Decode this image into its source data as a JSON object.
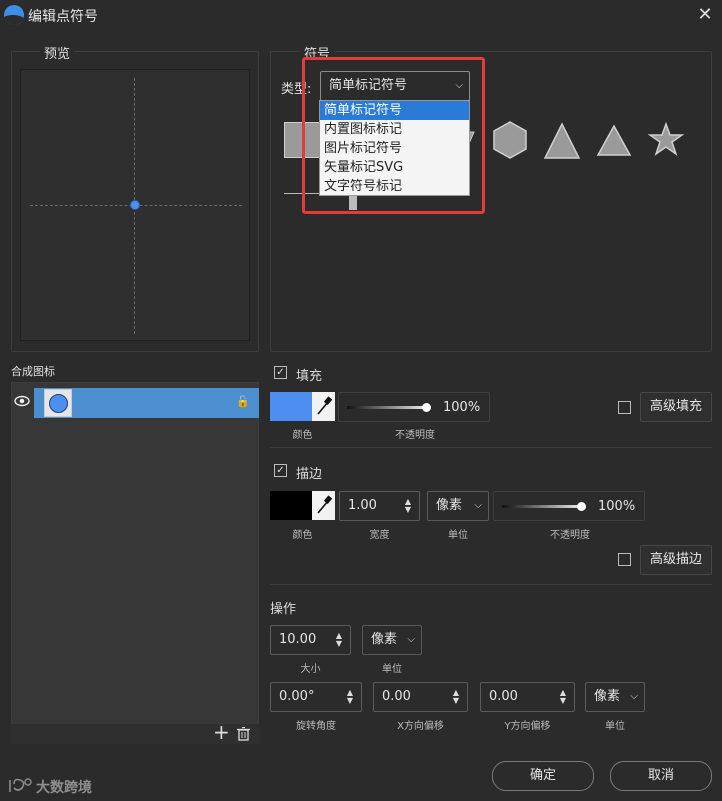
{
  "window": {
    "title": "编辑点符号",
    "close_glyph": "✕"
  },
  "preview": {
    "title": "预览",
    "point_color": "#4d8ff0"
  },
  "symbol": {
    "title": "符号",
    "type_label": "类型:",
    "type_value": "简单标记符号",
    "options": [
      "简单标记符号",
      "内置图标标记",
      "图片标记符号",
      "矢量标记SVG",
      "文字符号标记"
    ],
    "selected_index": 0
  },
  "composite": {
    "title": "合成图标",
    "add_glyph": "+",
    "delete_glyph": "🗑",
    "lock_glyph": "🔓"
  },
  "fill": {
    "label": "填充",
    "checked_glyph": "✓",
    "color": "#4d8ff0",
    "color_label": "颜色",
    "opacity_value": "100%",
    "opacity_fraction": 1.0,
    "opacity_label": "不透明度",
    "advanced_label": "高级填充"
  },
  "stroke": {
    "label": "描边",
    "checked_glyph": "✓",
    "color": "#000000",
    "color_label": "颜色",
    "width_value": "1.00",
    "width_label": "宽度",
    "unit_value": "像素",
    "unit_label": "单位",
    "opacity_value": "100%",
    "opacity_fraction": 1.0,
    "opacity_label": "不透明度",
    "advanced_label": "高级描边"
  },
  "operation": {
    "title": "操作",
    "size_value": "10.00",
    "size_label": "大小",
    "size_unit_value": "像素",
    "size_unit_label": "单位",
    "rotation_value": "0.00°",
    "rotation_label": "旋转角度",
    "xoffset_value": "0.00",
    "xoffset_label": "X方向偏移",
    "yoffset_value": "0.00",
    "yoffset_label": "Y方向偏移",
    "offset_unit_value": "像素",
    "offset_unit_label": "单位"
  },
  "footer": {
    "ok_label": "确定",
    "cancel_label": "取消"
  },
  "watermark": {
    "text": "大数跨境"
  },
  "colors": {
    "accent": "#4c8fd0",
    "highlight_box": "#e23b3b"
  }
}
